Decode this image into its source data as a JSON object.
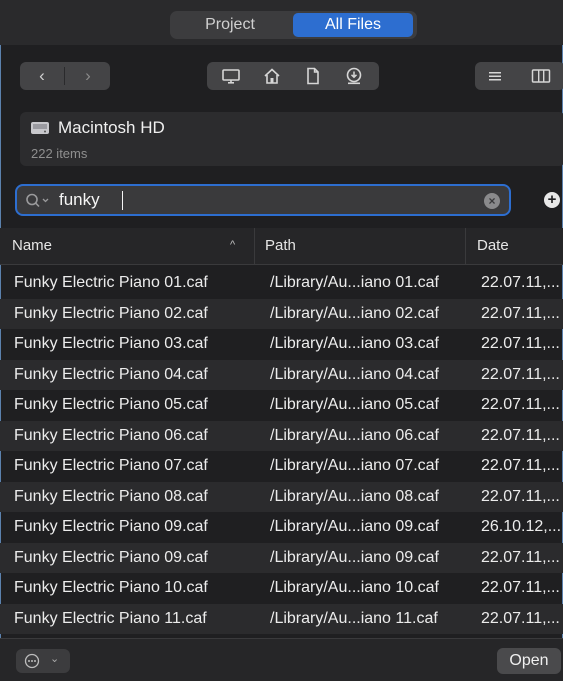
{
  "segmented": {
    "project_label": "Project",
    "all_files_label": "All Files"
  },
  "toolbar": {
    "back_glyph": "‹",
    "forward_glyph": "›",
    "places_icons": [
      "desktop-icon",
      "home-icon",
      "document-icon",
      "downloads-icon"
    ],
    "view_icons": [
      "list-view-icon",
      "column-view-icon"
    ]
  },
  "volume": {
    "name": "Macintosh HD",
    "count": "222 items"
  },
  "search": {
    "value": "funky"
  },
  "table": {
    "headers": [
      "Name",
      "Path",
      "Date"
    ],
    "sort_indicator": "^",
    "rows": [
      {
        "name": "Funky Electric Piano 01.caf",
        "path": "/Library/Au...iano 01.caf",
        "date": "22.07.11,..."
      },
      {
        "name": "Funky Electric Piano 02.caf",
        "path": "/Library/Au...iano 02.caf",
        "date": "22.07.11,..."
      },
      {
        "name": "Funky Electric Piano 03.caf",
        "path": "/Library/Au...iano 03.caf",
        "date": "22.07.11,..."
      },
      {
        "name": "Funky Electric Piano 04.caf",
        "path": "/Library/Au...iano 04.caf",
        "date": "22.07.11,..."
      },
      {
        "name": "Funky Electric Piano 05.caf",
        "path": "/Library/Au...iano 05.caf",
        "date": "22.07.11,..."
      },
      {
        "name": "Funky Electric Piano 06.caf",
        "path": "/Library/Au...iano 06.caf",
        "date": "22.07.11,..."
      },
      {
        "name": "Funky Electric Piano 07.caf",
        "path": "/Library/Au...iano 07.caf",
        "date": "22.07.11,..."
      },
      {
        "name": "Funky Electric Piano 08.caf",
        "path": "/Library/Au...iano 08.caf",
        "date": "22.07.11,..."
      },
      {
        "name": "Funky Electric Piano 09.caf",
        "path": "/Library/Au...iano 09.caf",
        "date": "26.10.12,..."
      },
      {
        "name": "Funky Electric Piano 09.caf",
        "path": "/Library/Au...iano 09.caf",
        "date": "22.07.11,..."
      },
      {
        "name": "Funky Electric Piano 10.caf",
        "path": "/Library/Au...iano 10.caf",
        "date": "22.07.11,..."
      },
      {
        "name": "Funky Electric Piano 11.caf",
        "path": "/Library/Au...iano 11.caf",
        "date": "22.07.11,..."
      }
    ]
  },
  "footer": {
    "open_label": "Open",
    "more_icon": "ellipsis-circle-icon"
  },
  "colors": {
    "accent": "#2d6ed0",
    "background": "#1f1f21"
  }
}
